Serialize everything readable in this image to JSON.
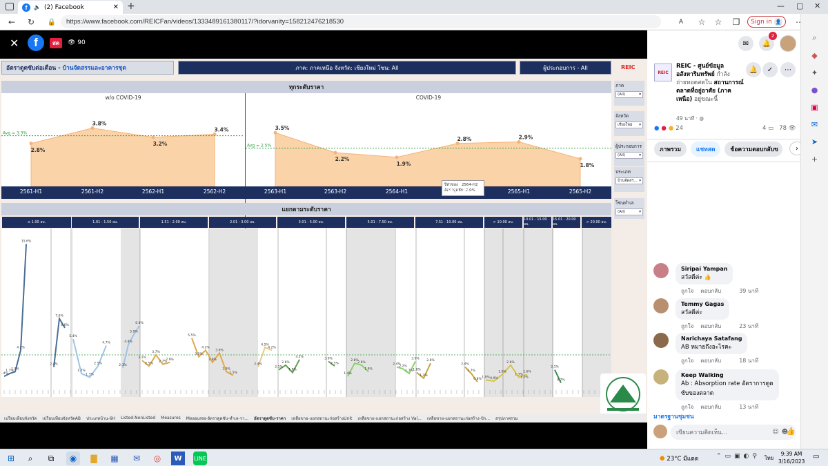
{
  "browser": {
    "tab_title": "(2) Facebook",
    "url": "https://www.facebook.com/REICFan/videos/1333489161380117/?idorvanity=158212476218530",
    "sign_in": "Sign in"
  },
  "video": {
    "live_label": "สด",
    "viewers": "90"
  },
  "dashboard": {
    "title_left": "อัตราดูดซับต่อเดือน - ",
    "title_highlight": "บ้านจัดสรรและอาคารชุด",
    "title_middle": "ภาค: ภาคเหนือ   จังหวัด: เชียงใหม่   โซน: All",
    "title_right": "ผู้ประกอบการ - All",
    "logo": "REIC",
    "section1": "ทุกระดับราคา",
    "sub_left": "w/o COVID-19",
    "sub_right": "COVID-19",
    "avg_left": "Avg = 3.3%",
    "avg_right": "Avg = 2.5%",
    "tooltip_l1_label": "ปีส่วของ",
    "tooltip_l1_value": "2564-H2",
    "tooltip_l2_label": "อัตราดูดซับ",
    "tooltip_l2_value": "2.0%",
    "section2": "แยกตามระดับราคา",
    "price_bands": [
      "≤ 1.00 ลบ.",
      "1.01 - 1.50 ลบ.",
      "1.51 - 2.00 ลบ.",
      "2.01 - 3.00 ลบ.",
      "3.01 - 5.00 ลบ.",
      "5.01 - 7.50 ลบ.",
      "7.51 - 10.00 ลบ.",
      "> 10.00 ลบ.",
      "10.01 - 15.00 ลบ.",
      "15.01 - 20.00 ลบ.",
      "> 20.00 ลบ."
    ],
    "filters": [
      {
        "label": "ภาค",
        "value": "(All)"
      },
      {
        "label": "จังหวัด",
        "value": "เชียงใหม่"
      },
      {
        "label": "ผู้ประกอบการ",
        "value": "(All)"
      },
      {
        "label": "ประเภท",
        "value": "บ้านจัดสร..."
      },
      {
        "label": "โซนทำเล",
        "value": "(All)"
      }
    ],
    "sheet_tabs": [
      "เปรียบเทียบจังหวัด",
      "เปรียบเทียบจังหวัดAB",
      "ประเภทบ้าน-6H",
      "Listed-NonListed",
      "Measures",
      "Measures-อัตราดูดซับ-ทำเล-รา...",
      "อัตราดูดซับ-ราคา",
      "เหลือขาย-แยกสถานะก่อสร้างUnit",
      "เหลือขาย-แยกสถานะก่อสร้าง Val...",
      "เหลือขาย-แยกสถานะก่อสร้าง-ปัก...",
      "สรุปภาพรวม"
    ]
  },
  "chart_data": [
    {
      "type": "area",
      "title": "ทุกระดับราคา",
      "categories": [
        "2561-H1",
        "2561-H2",
        "2562-H1",
        "2562-H2",
        "2563-H1",
        "2563-H2",
        "2564-H1",
        "2564-H2",
        "2565-H1",
        "2565-H2"
      ],
      "series": [
        {
          "values": [
            2.8,
            3.8,
            3.2,
            3.4,
            3.5,
            2.2,
            1.9,
            2.8,
            2.9,
            1.8
          ]
        }
      ],
      "data_labels": [
        "2.8%",
        "3.8%",
        "3.2%",
        "3.4%",
        "3.5%",
        "2.2%",
        "1.9%",
        "2.8%",
        "2.9%",
        "1.8%"
      ],
      "reference_lines": [
        {
          "label": "Avg = 3.3%",
          "value": 3.3
        },
        {
          "label": "Avg = 2.5%",
          "value": 2.5
        }
      ],
      "ylim": [
        0,
        4.5
      ]
    },
    {
      "type": "line",
      "title": "แยกตามระดับราคา",
      "labels": [
        {
          "band": 0,
          "text": "15.6%",
          "v": 15.6
        },
        {
          "band": 0,
          "text": "1.7%",
          "v": 1.7
        },
        {
          "band": 0,
          "text": "1.4%",
          "v": 1.4
        },
        {
          "band": 0,
          "text": "1.9%",
          "v": 1.9
        },
        {
          "band": 0,
          "text": "4.2%",
          "v": 4.2
        },
        {
          "band": 0,
          "text": "7.6%",
          "v": 7.6
        },
        {
          "band": 0,
          "text": "6.6%",
          "v": 6.6
        },
        {
          "band": 0,
          "text": "2.4%",
          "v": 2.4
        },
        {
          "band": 1,
          "text": "5.4%",
          "v": 5.4
        },
        {
          "band": 1,
          "text": "2.5%",
          "v": 2.5
        },
        {
          "band": 1,
          "text": "1.7%",
          "v": 1.7
        },
        {
          "band": 1,
          "text": "1.3%",
          "v": 1.3
        },
        {
          "band": 1,
          "text": "4.7%",
          "v": 4.7
        },
        {
          "band": 1,
          "text": "5.9%",
          "v": 5.9
        },
        {
          "band": 1,
          "text": "6.8%",
          "v": 6.8
        },
        {
          "band": 1,
          "text": "4.8%",
          "v": 4.8
        },
        {
          "band": 1,
          "text": "2.3%",
          "v": 2.3
        },
        {
          "band": 2,
          "text": "3.1%",
          "v": 3.1
        },
        {
          "band": 2,
          "text": "2.5%",
          "v": 2.5
        },
        {
          "band": 2,
          "text": "3.7%",
          "v": 3.7
        },
        {
          "band": 2,
          "text": "2.7%",
          "v": 2.7
        },
        {
          "band": 2,
          "text": "2.9%",
          "v": 2.9
        },
        {
          "band": 3,
          "text": "5.5%",
          "v": 5.5
        },
        {
          "band": 3,
          "text": "3.5%",
          "v": 3.5
        },
        {
          "band": 3,
          "text": "4.2%",
          "v": 4.2
        },
        {
          "band": 3,
          "text": "2.9%",
          "v": 2.9
        },
        {
          "band": 3,
          "text": "3.9%",
          "v": 3.9
        },
        {
          "band": 3,
          "text": "1.9%",
          "v": 1.9
        },
        {
          "band": 3,
          "text": "1.5%",
          "v": 1.5
        },
        {
          "band": 4,
          "text": "4.5%",
          "v": 4.5
        },
        {
          "band": 4,
          "text": "4.2%",
          "v": 4.2
        },
        {
          "band": 4,
          "text": "3.9%",
          "v": 3.9
        },
        {
          "band": 4,
          "text": "2.4%",
          "v": 2.4
        },
        {
          "band": 4,
          "text": "2.1%",
          "v": 2.1
        },
        {
          "band": 4,
          "text": "2.6%",
          "v": 2.6
        },
        {
          "band": 4,
          "text": "1.8%",
          "v": 1.8
        },
        {
          "band": 4,
          "text": "3.2%",
          "v": 3.2
        },
        {
          "band": 4,
          "text": "3.0%",
          "v": 3.0
        },
        {
          "band": 5,
          "text": "2.5%",
          "v": 2.5
        },
        {
          "band": 5,
          "text": "1.4%",
          "v": 1.4
        },
        {
          "band": 5,
          "text": "2.8%",
          "v": 2.8
        },
        {
          "band": 5,
          "text": "2.6%",
          "v": 2.6
        },
        {
          "band": 5,
          "text": "1.9%",
          "v": 1.9
        },
        {
          "band": 5,
          "text": "2.4%",
          "v": 2.4
        },
        {
          "band": 5,
          "text": "2.2%",
          "v": 2.2
        },
        {
          "band": 5,
          "text": "1.7%",
          "v": 1.7
        },
        {
          "band": 6,
          "text": "3.0%",
          "v": 3.0
        },
        {
          "band": 6,
          "text": "1.8%",
          "v": 1.8
        },
        {
          "band": 6,
          "text": "1.2%",
          "v": 1.2
        },
        {
          "band": 6,
          "text": "2.8%",
          "v": 2.8
        },
        {
          "band": 6,
          "text": "2.4%",
          "v": 2.4
        },
        {
          "band": 6,
          "text": "1.7%",
          "v": 1.7
        },
        {
          "band": 6,
          "text": "0.8%",
          "v": 0.8
        },
        {
          "band": 7,
          "text": "1.0%",
          "v": 1.0
        },
        {
          "band": 7,
          "text": "0.9%",
          "v": 0.9
        },
        {
          "band": 7,
          "text": "1.6%",
          "v": 1.6
        },
        {
          "band": 7,
          "text": "2.6%",
          "v": 2.6
        },
        {
          "band": 7,
          "text": "1.3%",
          "v": 1.3
        },
        {
          "band": 7,
          "text": "1.6%",
          "v": 1.6
        },
        {
          "band": 8,
          "text": "1.0%",
          "v": 1.0
        },
        {
          "band": 9,
          "text": "2.1%",
          "v": 2.1
        },
        {
          "band": 9,
          "text": "0.7%",
          "v": 0.7
        }
      ]
    }
  ],
  "facebook": {
    "page_name": "REIC - ศูนย์ข้อมูลอสังหาริมทรัพย์",
    "post_prefix": " กำลังถ่ายทอดสดใน ",
    "post_place": "สถานการณ์ตลาดที่อยู่อาศัย (ภาคเหนือ)",
    "post_suffix": " อยู่ขณะนี้",
    "time": "49 นาที · ",
    "reaction_count": "24",
    "comment_count": "4",
    "view_count": "78",
    "tabs": [
      "ภาพรวม",
      "แชทสด",
      "ข้อความตอบกลับข"
    ],
    "like_label": "ถูกใจ",
    "reply_label": "ตอบกลับ",
    "comments": [
      {
        "name": "Siripai Yampan",
        "text": "สวัสดีค่ะ",
        "time": "39 นาที"
      },
      {
        "name": "Temmy Gagas",
        "text": "สวัสดีค่ะ",
        "time": "23 นาที"
      },
      {
        "name": "Narichaya Satafang",
        "text": "AB หมายถึงอะไรคะ",
        "time": "18 นาที"
      },
      {
        "name": "Keep Walking",
        "text": "Ab : Absorption rate อัตราการดูดซับของตลาด",
        "time": "13 นาที"
      }
    ],
    "badge": "มาตรฐานชุมชน",
    "comment_placeholder": "เขียนความคิดเห็น...",
    "notif_count": "2"
  },
  "taskbar": {
    "weather": "23°C มีแดด",
    "lang": "ไทย",
    "time": "9:39 AM",
    "date": "3/16/2023"
  }
}
